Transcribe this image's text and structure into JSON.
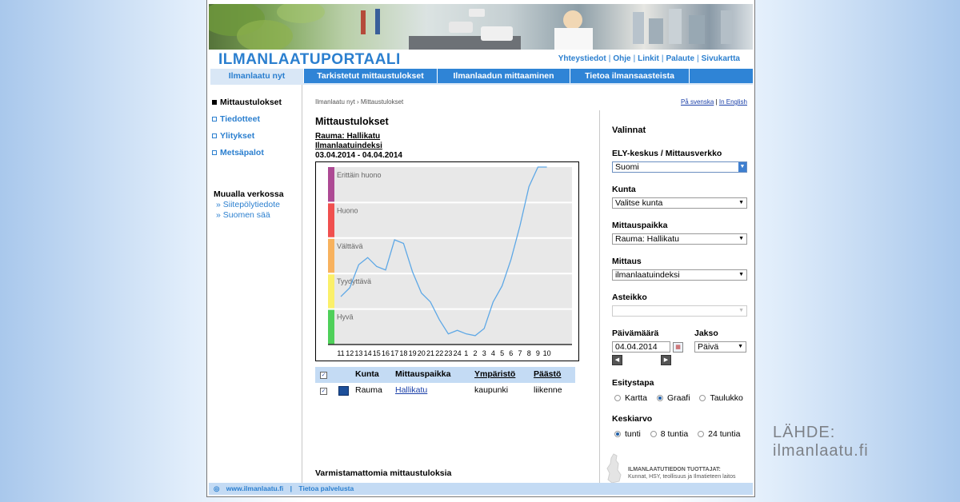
{
  "site": {
    "logo": "ILMANLAATUPORTAALI",
    "top_links": [
      "Yhteystiedot",
      "Ohje",
      "Linkit",
      "Palaute",
      "Sivukartta"
    ]
  },
  "nav": {
    "tabs": [
      "Ilmanlaatu nyt",
      "Tarkistetut mittaustulokset",
      "Ilmanlaadun mittaaminen",
      "Tietoa ilmansaasteista"
    ]
  },
  "sidebar": {
    "items": [
      "Mittaustulokset",
      "Tiedotteet",
      "Ylitykset",
      "Metsäpalot"
    ],
    "elsewhere_title": "Muualla verkossa",
    "elsewhere_links": [
      "Siitepölytiedote",
      "Suomen sää"
    ]
  },
  "main": {
    "breadcrumb": "Ilmanlaatu nyt › Mittaustulokset",
    "lang_sv": "På svenska",
    "lang_en": "In English",
    "title": "Mittaustulokset",
    "station": "Rauma: Hallikatu",
    "measure": "Ilmanlaatuindeksi",
    "date_range": "03.04.2014 - 04.04.2014",
    "footer_note": "Varmistamattomia mittaustuloksia"
  },
  "table": {
    "headers": [
      "Kunta",
      "Mittauspaikka",
      "Ympäristö",
      "Päästö"
    ],
    "rows": [
      {
        "kunta": "Rauma",
        "paikka": "Hallikatu",
        "ymparisto": "kaupunki",
        "paasto": "liikenne"
      }
    ]
  },
  "panel": {
    "title": "Valinnat",
    "ely_label": "ELY-keskus / Mittausverkko",
    "ely_value": "Suomi",
    "kunta_label": "Kunta",
    "kunta_value": "Valitse kunta",
    "paikka_label": "Mittauspaikka",
    "paikka_value": "Rauma: Hallikatu",
    "mittaus_label": "Mittaus",
    "mittaus_value": "ilmanlaatuindeksi",
    "asteikko_label": "Asteikko",
    "asteikko_value": "",
    "paiva_label": "Päivämäärä",
    "paiva_value": "04.04.2014",
    "jakso_label": "Jakso",
    "jakso_value": "Päivä",
    "esitys_label": "Esitystapa",
    "esitys_options": [
      "Kartta",
      "Graafi",
      "Taulukko"
    ],
    "esitys_selected": "Graafi",
    "keskiarvo_label": "Keskiarvo",
    "keskiarvo_options": [
      "tunti",
      "8 tuntia",
      "24 tuntia"
    ],
    "keskiarvo_selected": "tunti",
    "producers_title": "ILMANLAATUTIEDON TUOTTAJAT:",
    "producers_text": "Kunnat, HSY, teollisuus ja Ilmatieteen laitos"
  },
  "footer": {
    "site": "www.ilmanlaatu.fi",
    "about": "Tietoa palvelusta"
  },
  "source": {
    "line1": "LÄHDE:",
    "line2": "ilmanlaatu.fi"
  },
  "chart_data": {
    "type": "line",
    "x": [
      "11",
      "12",
      "13",
      "14",
      "15",
      "16",
      "17",
      "18",
      "19",
      "20",
      "21",
      "22",
      "23",
      "24",
      "1",
      "2",
      "3",
      "4",
      "5",
      "6",
      "7",
      "8",
      "9",
      "10"
    ],
    "y_categories": [
      "Hyvä",
      "Tyydyttävä",
      "Välttävä",
      "Huono",
      "Erittäin huono"
    ],
    "band_colors": [
      "#4fd05a",
      "#fbf06a",
      "#f8b25e",
      "#f0504f",
      "#ad4a94"
    ],
    "ylim": [
      0,
      5
    ],
    "values": [
      1.35,
      1.6,
      2.25,
      2.45,
      2.2,
      2.1,
      2.95,
      2.85,
      2.05,
      1.45,
      1.2,
      0.7,
      0.3,
      0.4,
      0.3,
      0.25,
      0.45,
      1.2,
      1.65,
      2.4,
      3.35,
      4.45,
      5.0,
      5.0
    ],
    "series_color": "#5ea8e6"
  }
}
